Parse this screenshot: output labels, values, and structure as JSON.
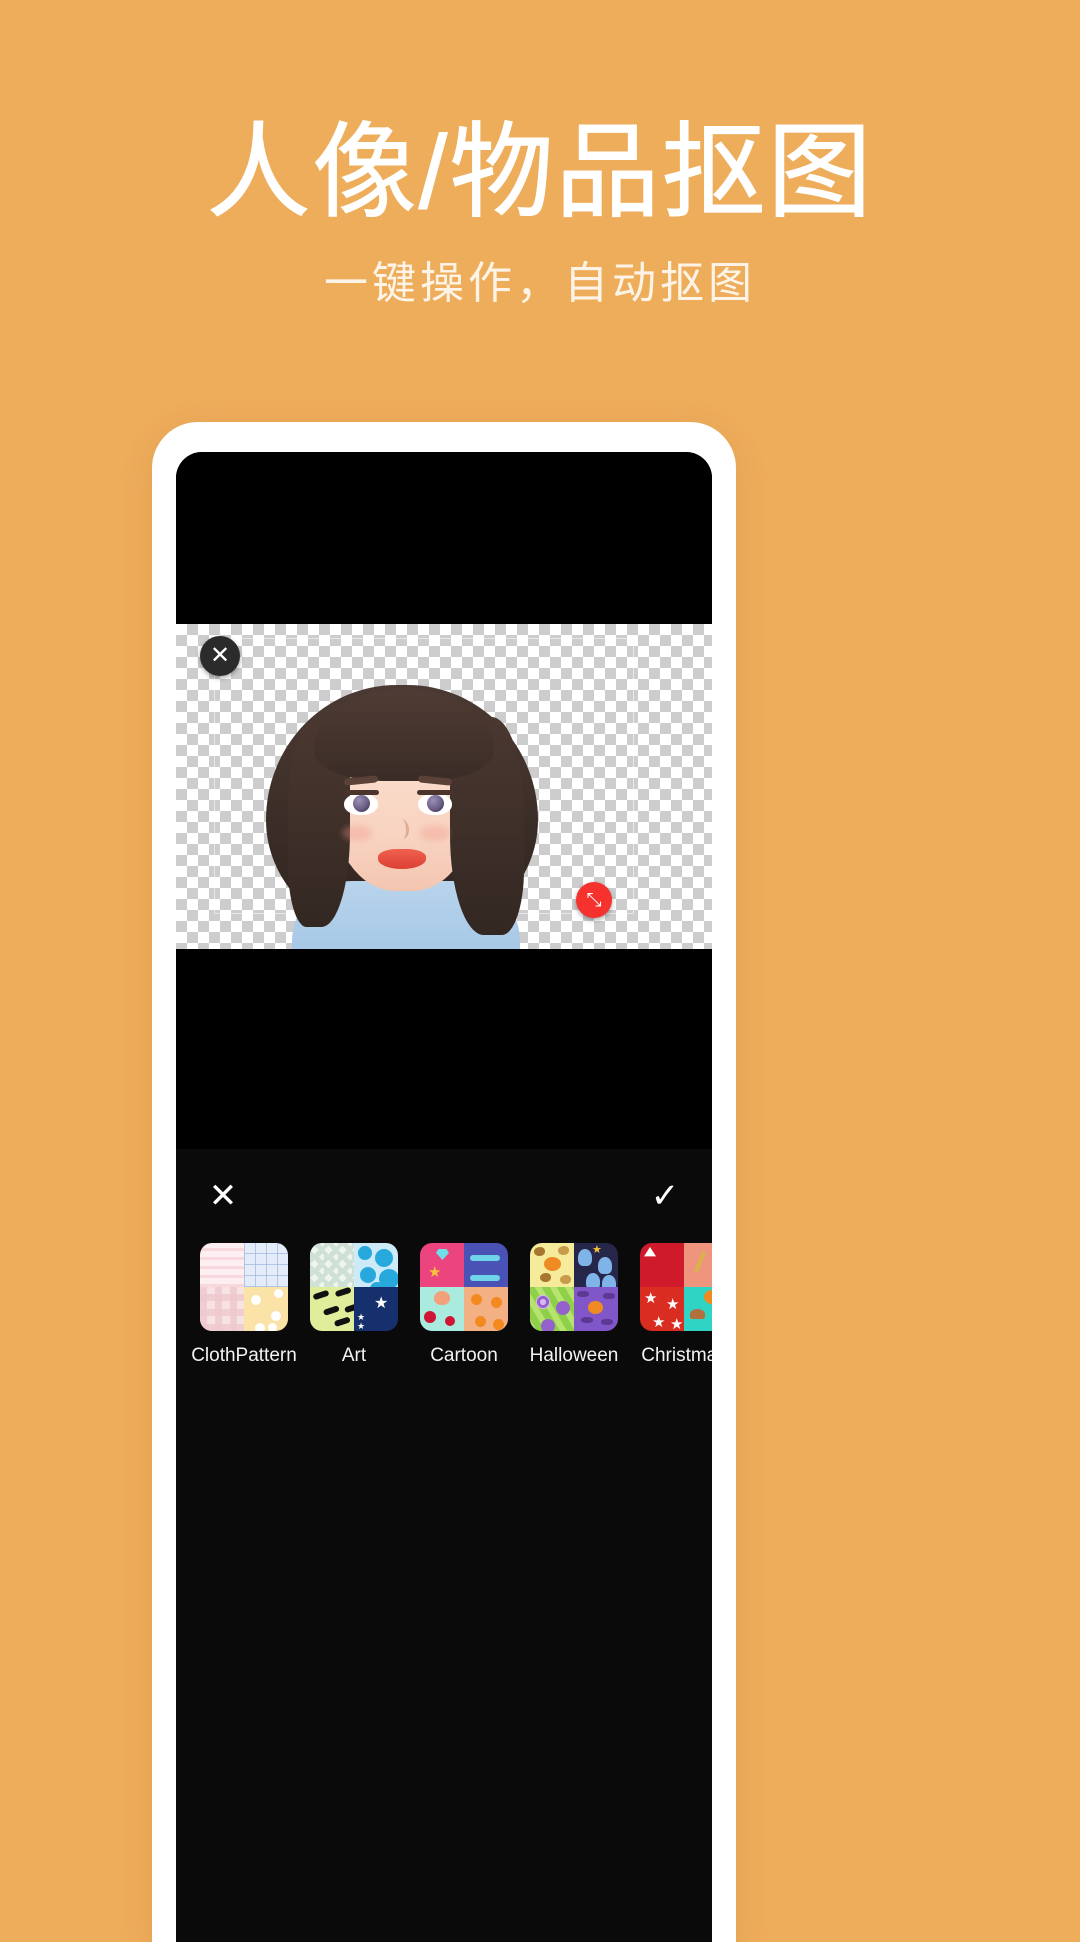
{
  "promo": {
    "title": "人像/物品抠图",
    "subtitle": "一键操作，自动抠图",
    "background_color": "#eead5b",
    "text_color": "#ffffff"
  },
  "phone": {
    "frame_color": "#ffffff",
    "screen_background": "#000000"
  },
  "canvas": {
    "name": "transparent-checkerboard-canvas",
    "checker_light": "#ffffff",
    "checker_dark": "#cdcdcd",
    "delete_handle_icon": "✕",
    "resize_handle_icon": "⤡",
    "delete_handle_color": "#2b2b2b",
    "resize_handle_color": "#f5322e"
  },
  "editor": {
    "cancel_icon": "✕",
    "confirm_icon": "✓",
    "panel_color": "#0a0a0a",
    "thumbnails": [
      {
        "label": "ClothPattern",
        "quadrant_classes": [
          "cp1",
          "cp2",
          "cp3",
          "cp4"
        ]
      },
      {
        "label": "Art",
        "quadrant_classes": [
          "a1",
          "a2",
          "a3",
          "a4"
        ]
      },
      {
        "label": "Cartoon",
        "quadrant_classes": [
          "c1",
          "c2",
          "c3",
          "c4"
        ]
      },
      {
        "label": "Halloween",
        "quadrant_classes": [
          "h1",
          "h2",
          "h3",
          "h4"
        ]
      },
      {
        "label": "Christmas",
        "quadrant_classes": [
          "x1",
          "x2",
          "x3",
          "x4"
        ]
      },
      {
        "label": "",
        "quadrant_classes": [
          "e1",
          "e2",
          "e3",
          "e4"
        ]
      }
    ]
  }
}
